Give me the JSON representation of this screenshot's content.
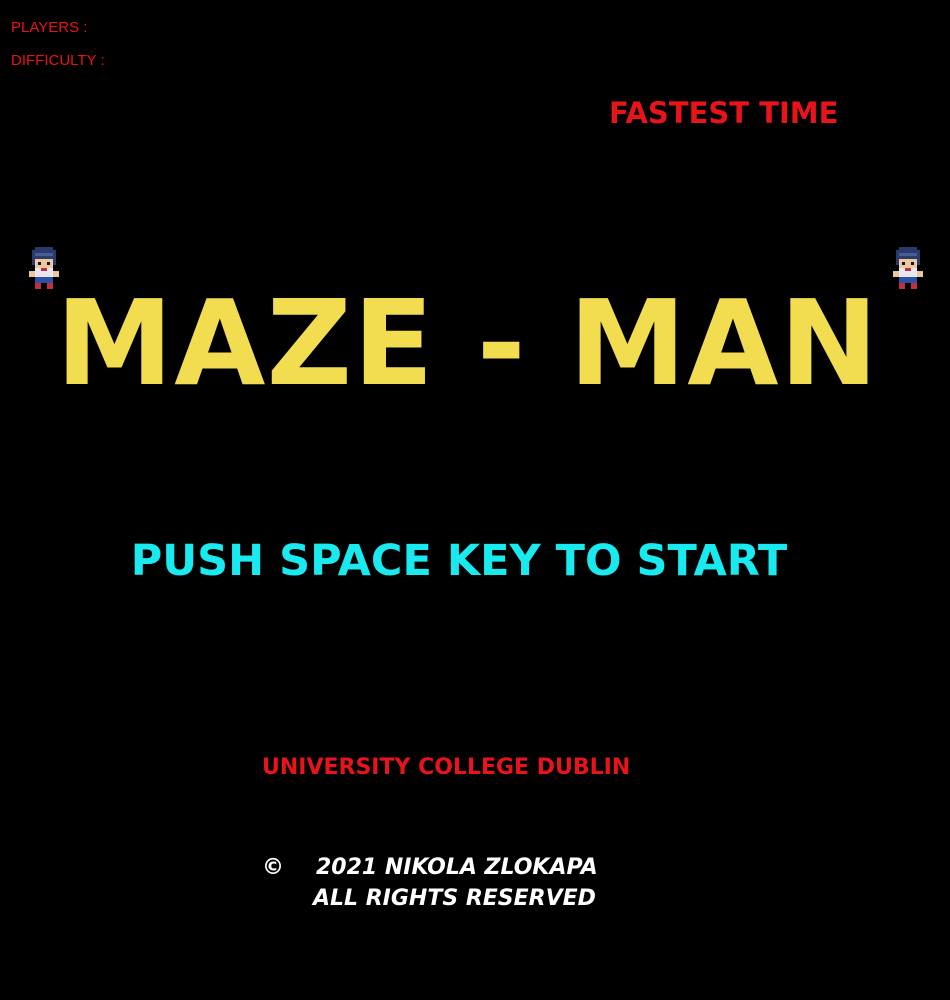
{
  "hud": {
    "players_label": "PLAYERS :",
    "difficulty_label": "DIFFICULTY :"
  },
  "high_score": {
    "label": "FASTEST TIME"
  },
  "title": "MAZE - MAN",
  "prompt": "PUSH SPACE KEY TO START",
  "institution": "UNIVERSITY COLLEGE DUBLIN",
  "credits": {
    "symbol": "©",
    "line1": "2021 NIKOLA ZLOKAPA",
    "line2": "ALL RIGHTS RESERVED"
  },
  "sprites": {
    "left_icon": "maze-man-character-icon",
    "right_icon": "maze-man-character-icon"
  },
  "colors": {
    "background": "#000000",
    "red": "#e8141a",
    "yellow": "#f2dc50",
    "cyan": "#18eaf0",
    "white": "#ffffff"
  }
}
